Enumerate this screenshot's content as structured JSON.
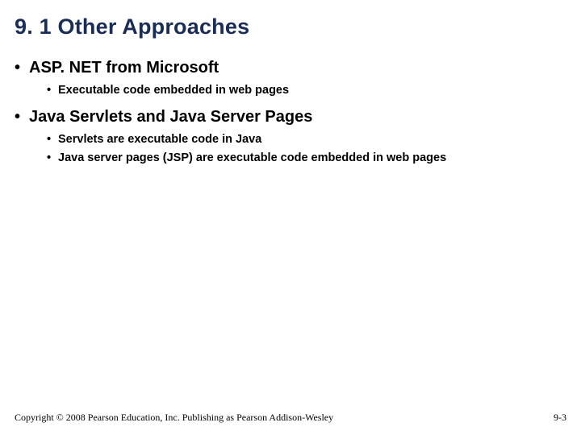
{
  "title": "9. 1 Other Approaches",
  "bullets": {
    "b1": {
      "label": "ASP. NET from Microsoft",
      "sub": {
        "s1": "Executable code embedded in web pages"
      }
    },
    "b2": {
      "label": "Java Servlets and Java Server Pages",
      "sub": {
        "s1": "Servlets are executable code in Java",
        "s2": "Java server pages (JSP) are executable code embedded in web pages"
      }
    }
  },
  "footer": {
    "copyright": "Copyright © 2008 Pearson Education, Inc. Publishing as Pearson Addison-Wesley",
    "page": "9-3"
  }
}
